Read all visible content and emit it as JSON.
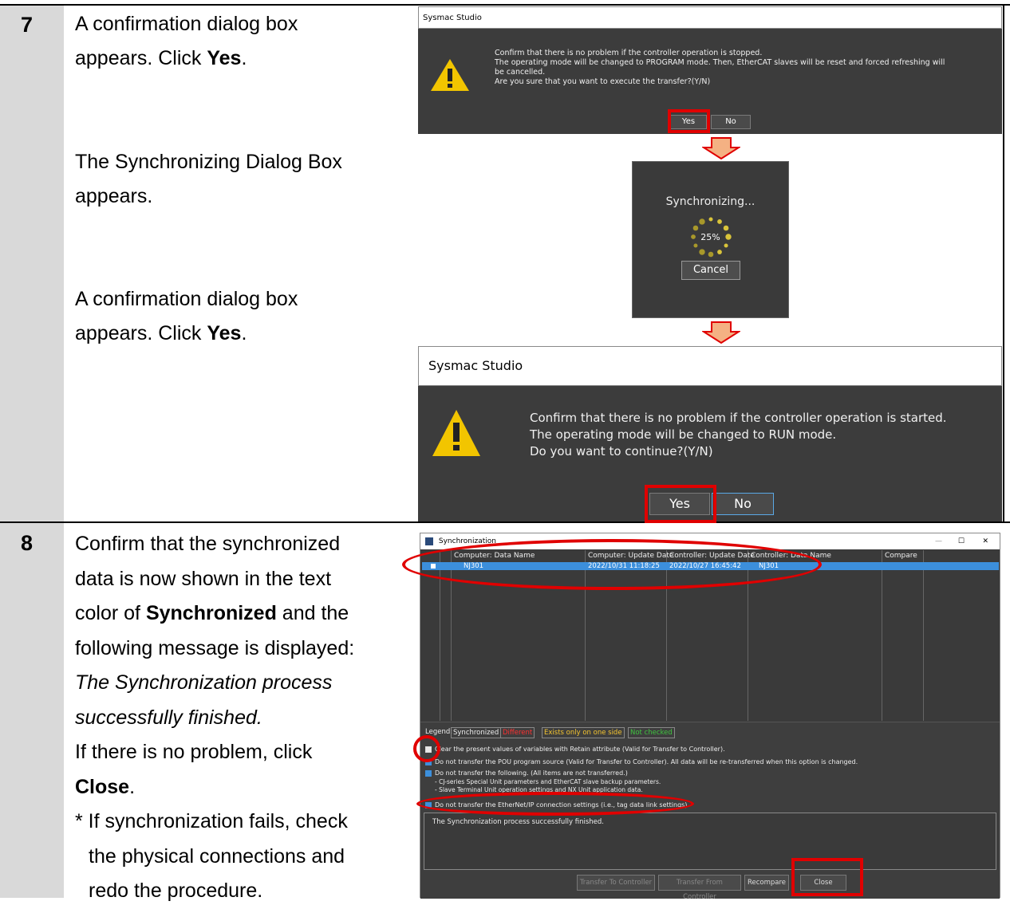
{
  "step7": {
    "number": "7",
    "para1_a": "A confirmation dialog box",
    "para1_b": "appears. Click ",
    "para1_bold": "Yes",
    "para1_end": ".",
    "para2_a": "The Synchronizing Dialog Box",
    "para2_b": "appears.",
    "para3_a": "A confirmation dialog box",
    "para3_b": "appears. Click ",
    "para3_bold": "Yes",
    "para3_end": "."
  },
  "dialog1": {
    "title": "Sysmac Studio",
    "line1": "Confirm that there is no problem if the controller operation is stopped.",
    "line2": "The operating mode will be changed to PROGRAM mode. Then, EtherCAT slaves will be reset and forced refreshing will",
    "line3": "be cancelled.",
    "line4": "Are you sure that you want to execute the transfer?(Y/N)",
    "yes": "Yes",
    "no": "No"
  },
  "progress_dialog": {
    "label": "Synchronizing...",
    "percent": "25%",
    "progress_value": 25,
    "cancel": "Cancel"
  },
  "dialog2": {
    "title": "Sysmac Studio",
    "line1": "Confirm that there is no problem if the controller operation is started.",
    "line2": "The operating mode will be changed to RUN mode.",
    "line3": "Do you want to continue?(Y/N)",
    "yes": "Yes",
    "no": "No"
  },
  "step8": {
    "number": "8",
    "l1": "Confirm that the synchronized",
    "l2": "data is now shown in the text",
    "l3a": "color of ",
    "l3bold": "Synchronized",
    "l3b": " and the",
    "l4": "following message is displayed:",
    "l5": "The Synchronization process",
    "l6": "successfully finished.",
    "l7": "If there is no problem, click",
    "l8bold": "Close",
    "l8end": ".",
    "note1": "* If synchronization fails, check",
    "note2": "the physical connections and",
    "note3": "redo the procedure."
  },
  "sync_window": {
    "title": "Synchronization",
    "headers": [
      "Computer: Data Name",
      "Computer: Update Date",
      "Controller: Update Date",
      "Controller: Data Name",
      "Compare"
    ],
    "row": [
      "NJ301",
      "2022/10/31 11:18:25",
      "2022/10/27 16:45:42",
      "NJ301"
    ],
    "legend_label": "Legend:",
    "legend": [
      "Synchronized",
      "Different",
      "Exists only on one side",
      "Not checked"
    ],
    "option1": "Clear the present values of variables with Retain attribute (Valid for Transfer to Controller).",
    "option2": "Do not transfer the POU program source (Valid for Transfer to Controller). All data will be re-transferred when this option is changed.",
    "option3": "Do not transfer the following. (All items are not transferred.)",
    "option3_sub1": "- CJ-series Special Unit parameters and EtherCAT slave backup parameters.",
    "option3_sub2": "- Slave Terminal Unit operation settings and NX Unit application data.",
    "option4": "Do not transfer the EtherNet/IP connection settings (i.e., tag data link settings).",
    "message": "The Synchronization process successfully finished.",
    "btn_to": "Transfer To Controller",
    "btn_from": "Transfer From Controller",
    "btn_recompare": "Recompare",
    "btn_close": "Close",
    "win_min": "—",
    "win_max": "☐",
    "win_close": "✕"
  }
}
